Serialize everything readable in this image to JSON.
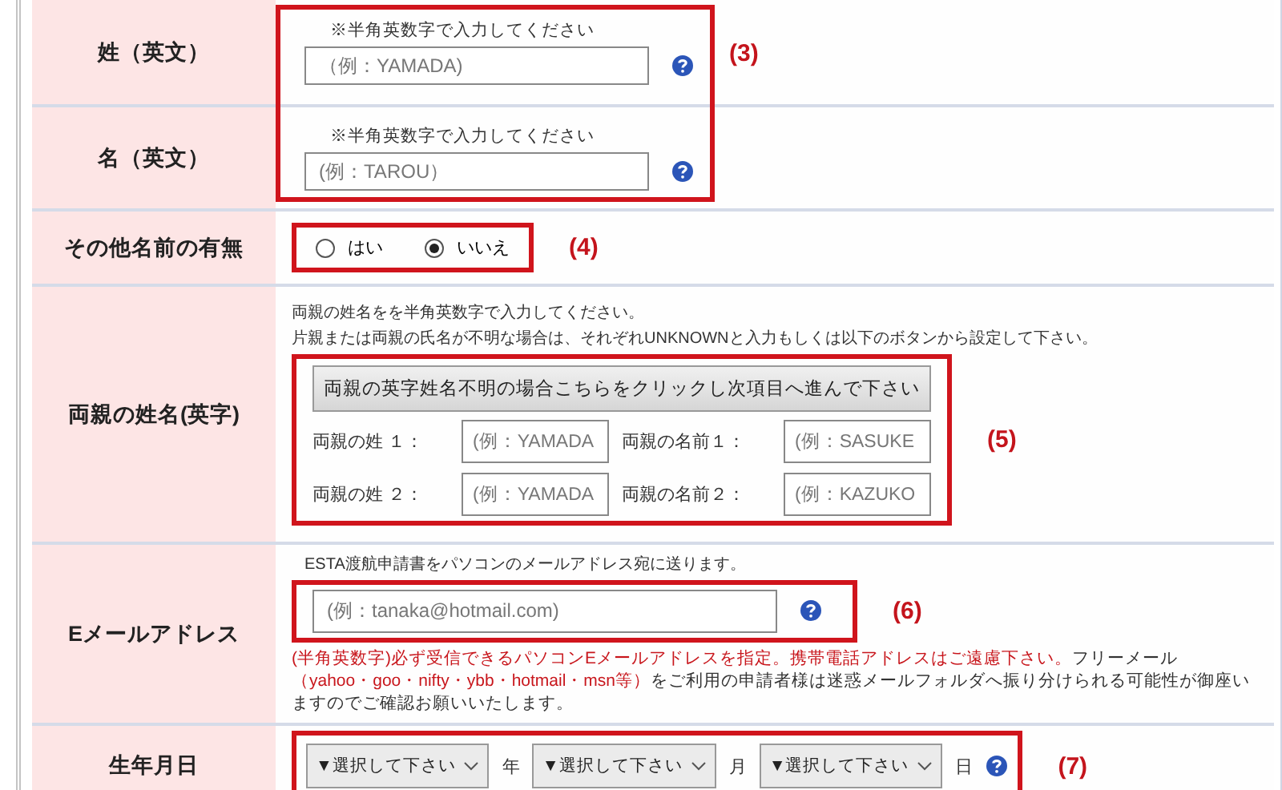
{
  "rows": [
    {
      "label": "姓（英文）",
      "kind": "text",
      "note": "※半角英数字で入力してください",
      "placeholder": "（例：YAMADA)",
      "help": true,
      "annotation": "(3)"
    },
    {
      "label": "名（英文）",
      "kind": "text",
      "note": "※半角英数字で入力してください",
      "placeholder": "(例：TAROU）",
      "help": true
    },
    {
      "label": "その他名前の有無",
      "kind": "radio",
      "options": [
        {
          "label": "はい",
          "selected": false
        },
        {
          "label": "いいえ",
          "selected": true
        }
      ],
      "annotation": "(4)"
    },
    {
      "label": "両親の姓名(英字)",
      "kind": "parents",
      "notes": [
        "両親の姓名をを半角英数字で入力してください。",
        "片親または両親の氏名が不明な場合は、それぞれUNKNOWNと入力もしくは以下のボタンから設定して下さい。"
      ],
      "button": "両親の英字姓名不明の場合こちらをクリックし次項目へ進んで下さい",
      "fields": [
        {
          "label": "両親の姓 １：",
          "placeholder": "(例：YAMADA"
        },
        {
          "label": "両親の名前１：",
          "placeholder": "(例：SASUKE"
        },
        {
          "label": "両親の姓 ２：",
          "placeholder": "(例：YAMADA"
        },
        {
          "label": "両親の名前２：",
          "placeholder": "(例：KAZUKO"
        }
      ],
      "annotation": "(5)"
    },
    {
      "label": "Eメールアドレス",
      "kind": "email",
      "note": "ESTA渡航申請書をパソコンのメールアドレス宛に送ります。",
      "placeholder": "(例：tanaka@hotmail.com)",
      "help": true,
      "annotation": "(6)",
      "warning": [
        {
          "text": "(半角英数字)必ず受信できるパソコンEメールアドレスを指定。携帯電話アドレスはご遠慮下さい。",
          "red": true
        },
        {
          "text": "フリーメール",
          "red": false
        },
        {
          "text": "（yahoo・goo・nifty・ybb・hotmail・msn等）",
          "red": true
        },
        {
          "text": "をご利用の申請者様は迷惑メールフォルダへ振り分けられる可能性が御座いますのでご確認お願いいたします。",
          "red": false
        }
      ]
    },
    {
      "label": "生年月日",
      "kind": "date",
      "selects": [
        {
          "value": "▼選択して下さい",
          "unit": "年"
        },
        {
          "value": "▼選択して下さい",
          "unit": "月"
        },
        {
          "value": "▼選択して下さい",
          "unit": "日"
        }
      ],
      "help": true,
      "annotation": "(7)"
    }
  ]
}
